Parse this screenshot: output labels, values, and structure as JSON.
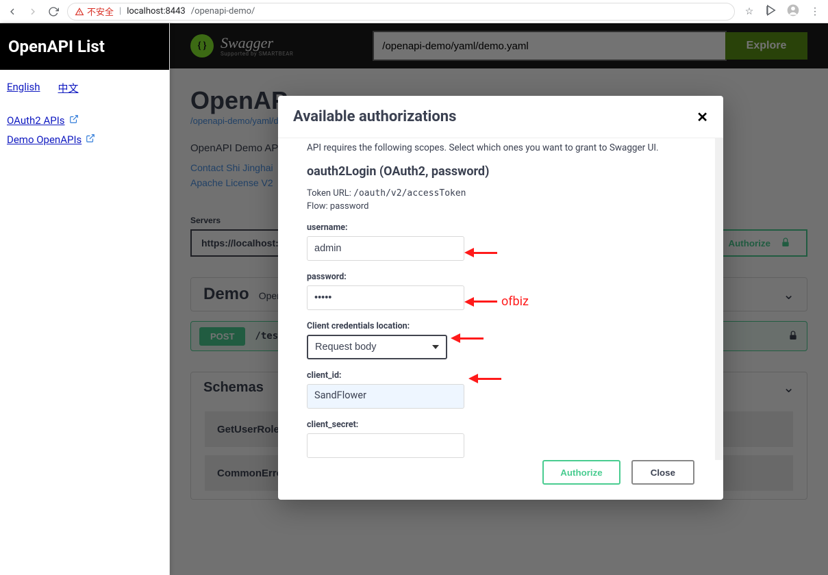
{
  "browser": {
    "insecure_label": "不安全",
    "url_host": "localhost:8443",
    "url_path": "/openapi-demo/"
  },
  "sidebar": {
    "title": "OpenAPI List",
    "lang_en": "English",
    "lang_zh": "中文",
    "api_links": [
      {
        "label": "OAuth2 APIs"
      },
      {
        "label": "Demo OpenAPIs"
      }
    ]
  },
  "swagger": {
    "brand": "Swagger",
    "brand_sub": "Supported by SMARTBEAR",
    "search_value": "/openapi-demo/yaml/demo.yaml",
    "explore": "Explore",
    "api_title": "OpenAP",
    "yaml_path": "/openapi-demo/yaml/d",
    "api_desc": "OpenAPI Demo APIs",
    "contact": "Contact Shi Jinghai",
    "license": "Apache License V2",
    "servers_label": "Servers",
    "server": "https://localhost:",
    "authorize": "Authorize",
    "tag_name": "Demo",
    "tag_desc": "Open",
    "op_method": "POST",
    "op_path": "/test",
    "schemas": "Schemas",
    "schema_items": [
      "GetUserRolesSuccess",
      "CommonError"
    ]
  },
  "modal": {
    "title": "Available authorizations",
    "scopes_text": "API requires the following scopes. Select which ones you want to grant to Swagger UI.",
    "auth_heading": "oauth2Login (OAuth2, password)",
    "token_url_label": "Token URL:",
    "token_url": "/oauth/v2/accessToken",
    "flow_label": "Flow:",
    "flow": "password",
    "username_label": "username:",
    "username_value": "admin",
    "password_label": "password:",
    "password_value": "•••••",
    "cred_loc_label": "Client credentials location:",
    "cred_loc_value": "Request body",
    "client_id_label": "client_id:",
    "client_id_value": "SandFlower",
    "client_secret_label": "client_secret:",
    "client_secret_value": "",
    "authorize_btn": "Authorize",
    "close_btn": "Close"
  },
  "annotations": {
    "password_hint": "ofbiz"
  }
}
